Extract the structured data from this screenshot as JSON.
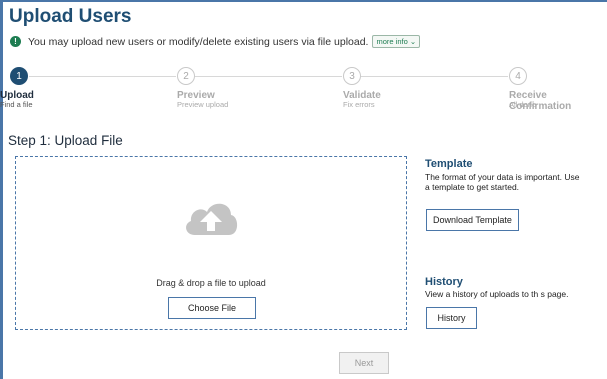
{
  "page": {
    "title": "Upload Users"
  },
  "info": {
    "message": "You may upload new users or modify/delete existing users via file upload.",
    "more_label": "more info",
    "icon": "info-circle-icon"
  },
  "steps": [
    {
      "number": "1",
      "title": "Upload",
      "subtitle": "Find a file",
      "active": true
    },
    {
      "number": "2",
      "title": "Preview",
      "subtitle": "Preview upload",
      "active": false
    },
    {
      "number": "3",
      "title": "Validate",
      "subtitle": "Fix errors",
      "active": false
    },
    {
      "number": "4",
      "title": "Receive Confirmation",
      "subtitle": "All done",
      "active": false
    }
  ],
  "section": {
    "heading": "Step 1: Upload File"
  },
  "dropzone": {
    "text": "Drag & drop a file to upload",
    "button_label": "Choose File",
    "icon": "cloud-upload-icon"
  },
  "template": {
    "heading": "Template",
    "text": "The format of your data is important. Use a template to get started.",
    "button_label": "Download Template"
  },
  "history": {
    "heading": "History",
    "text": "View a history of uploads to th s page.",
    "button_label": "History"
  },
  "footer": {
    "next_label": "Next"
  },
  "colors": {
    "primary": "#1f4e73",
    "accent": "#4a76a8",
    "info_green": "#1e7d52"
  }
}
